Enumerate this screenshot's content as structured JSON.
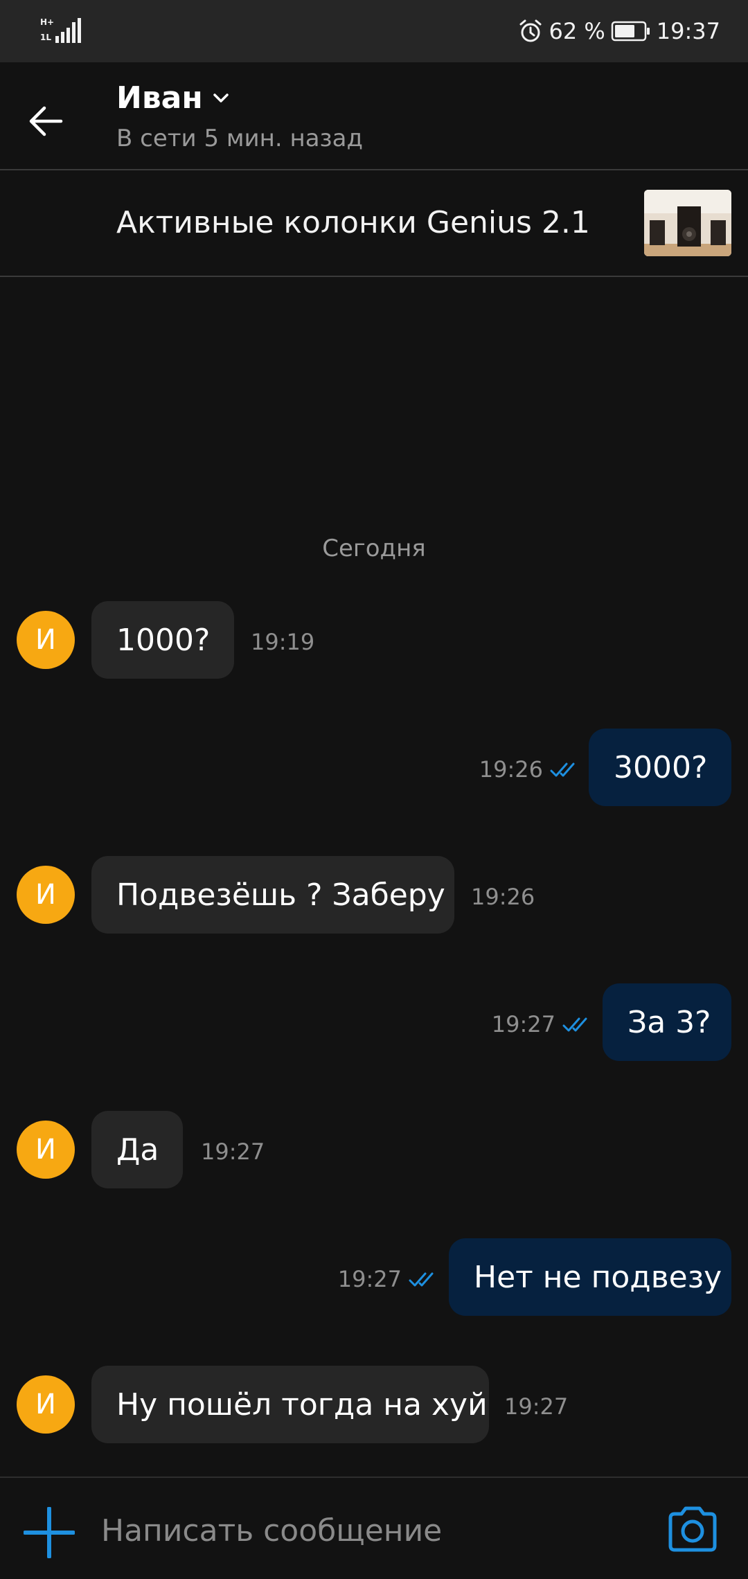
{
  "status_bar": {
    "battery_text": "62 %",
    "time": "19:37",
    "icons": [
      "signal-icon",
      "alarm-icon",
      "battery-icon"
    ]
  },
  "header": {
    "contact_name": "Иван",
    "contact_status": "В сети 5 мин. назад",
    "icons": [
      "back-arrow-icon",
      "chevron-down-icon"
    ]
  },
  "listing": {
    "title": "Активные колонки Genius 2.1",
    "thumbnail": "speakers-photo"
  },
  "chat": {
    "date_separator": "Сегодня",
    "avatar_letter": "И",
    "messages": [
      {
        "direction": "in",
        "text": "1000?",
        "time": "19:19"
      },
      {
        "direction": "out",
        "text": "3000?",
        "time": "19:26",
        "read": true
      },
      {
        "direction": "in",
        "text": "Подвезёшь ? Заберу",
        "time": "19:26"
      },
      {
        "direction": "out",
        "text": "За 3?",
        "time": "19:27",
        "read": true
      },
      {
        "direction": "in",
        "text": "Да",
        "time": "19:27"
      },
      {
        "direction": "out",
        "text": "Нет не подвезу",
        "time": "19:27",
        "read": true
      },
      {
        "direction": "in",
        "text": "Ну пошёл тогда на хуй",
        "time": "19:27"
      }
    ]
  },
  "composer": {
    "placeholder": "Написать сообщение",
    "value": "",
    "icons": [
      "plus-icon",
      "camera-icon"
    ]
  },
  "colors": {
    "background": "#121212",
    "status_bar": "#262626",
    "incoming_bubble": "#262626",
    "outgoing_bubble": "#06213f",
    "avatar": "#f7a812",
    "accent": "#1e90e0",
    "secondary_text": "#9a9a9a"
  }
}
